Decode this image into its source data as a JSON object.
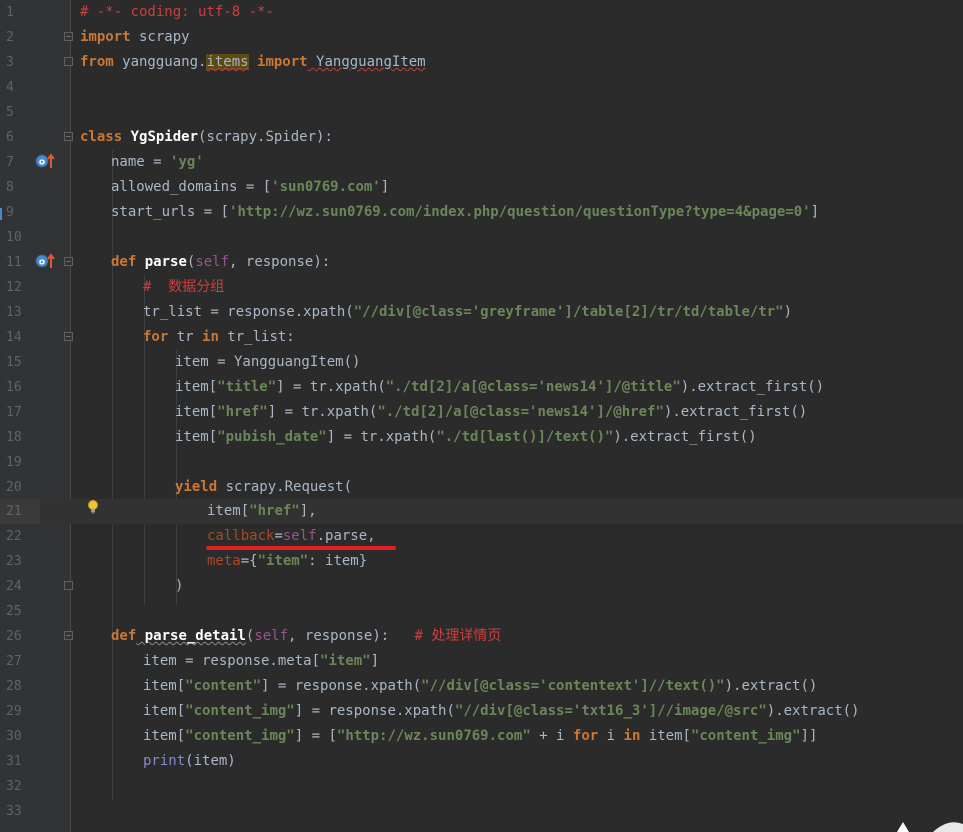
{
  "editor": {
    "language": "python",
    "current_line": 21,
    "colors": {
      "background": "#2b2b2b",
      "gutter": "#313335",
      "keyword": "#cc7832",
      "string": "#6a8759",
      "comment": "#cc3f3f",
      "function": "#ffc66d",
      "self": "#94558d",
      "annotation_underline": "#e0201e"
    },
    "line_numbers": [
      "1",
      "2",
      "3",
      "4",
      "5",
      "6",
      "7",
      "8",
      "9",
      "10",
      "11",
      "12",
      "13",
      "14",
      "15",
      "16",
      "17",
      "18",
      "19",
      "20",
      "21",
      "22",
      "23",
      "24",
      "25",
      "26",
      "27",
      "28",
      "29",
      "30",
      "31",
      "32",
      "33"
    ],
    "tokens": {
      "l1_comment": "# -*- coding: utf-8 -*-",
      "l2_import": "import",
      "l2_mod": " scrapy",
      "l3_from": "from",
      "l3_mod_a": " yangguang.",
      "l3_mod_b": "items",
      "l3_import": " import",
      "l3_cls": " YangguangItem",
      "l6_class": "class",
      "l6_name": " YgSpider",
      "l6_rest": "(scrapy.Spider):",
      "l7_a": "name = ",
      "l7_s": "'yg'",
      "l8_a": "allowed_domains = [",
      "l8_s": "'sun0769.com'",
      "l8_b": "]",
      "l9_a": "start_urls = [",
      "l9_s": "'http://wz.sun0769.com/index.php/question/questionType?type=4&page=0'",
      "l9_b": "]",
      "l11_def": "def",
      "l11_fn": " parse",
      "l11_p1": "(",
      "l11_self": "self",
      "l11_p2": ", response):",
      "l12_comment": "#  数据分组",
      "l13_a": "tr_list = response.xpath(",
      "l13_s": "\"//div[@class='greyframe']/table[2]/tr/td/table/tr\"",
      "l13_b": ")",
      "l14_for": "for",
      "l14_a": " tr ",
      "l14_in": "in",
      "l14_b": " tr_list:",
      "l15_a": "item = YangguangItem()",
      "l16_a": "item[",
      "l16_s1": "\"title\"",
      "l16_b": "] = tr.xpath(",
      "l16_s2": "\"./td[2]/a[@class='news14']/@title\"",
      "l16_c": ").extract_first()",
      "l17_a": "item[",
      "l17_s1": "\"href\"",
      "l17_b": "] = tr.xpath(",
      "l17_s2": "\"./td[2]/a[@class='news14']/@href\"",
      "l17_c": ").extract_first()",
      "l18_a": "item[",
      "l18_s1": "\"pubish_date\"",
      "l18_b": "] = tr.xpath(",
      "l18_s2": "\"./td[last()]/text()\"",
      "l18_c": ").extract_first()",
      "l20_yield": "yield",
      "l20_a": " scrapy.Request(",
      "l21_a": "item[",
      "l21_s": "\"href\"",
      "l21_b": "],",
      "l22_kw": "callback",
      "l22_eq": "=",
      "l22_self": "self",
      "l22_b": ".parse,",
      "l23_kw": "meta",
      "l23_a": "={",
      "l23_s": "\"item\"",
      "l23_b": ": item}",
      "l24_a": ")",
      "l26_def": "def",
      "l26_fn": " parse_detail",
      "l26_p1": "(",
      "l26_self": "self",
      "l26_p2": ", response):   ",
      "l26_comment": "# 处理详情页",
      "l27_a": "item = response.meta[",
      "l27_s": "\"item\"",
      "l27_b": "]",
      "l28_a": "item[",
      "l28_s1": "\"content\"",
      "l28_b": "] = response.xpath(",
      "l28_s2": "\"//div[@class='contentext']//text()\"",
      "l28_c": ").extract()",
      "l29_a": "item[",
      "l29_s1": "\"content_img\"",
      "l29_b": "] = response.xpath(",
      "l29_s2": "\"//div[@class='txt16_3']//image/@src\"",
      "l29_c": ").extract()",
      "l30_a": "item[",
      "l30_s1": "\"content_img\"",
      "l30_b": "] = [",
      "l30_s2": "\"http://wz.sun0769.com\"",
      "l30_c": " + i ",
      "l30_for": "for",
      "l30_d": " i ",
      "l30_in": "in",
      "l30_e": " item[",
      "l30_s3": "\"content_img\"",
      "l30_f": "]]",
      "l31_print": "print",
      "l31_a": "(item)"
    },
    "gutter_icons": {
      "override_1": "override-method-icon",
      "override_2": "override-method-icon",
      "intention": "lightbulb-icon"
    }
  }
}
